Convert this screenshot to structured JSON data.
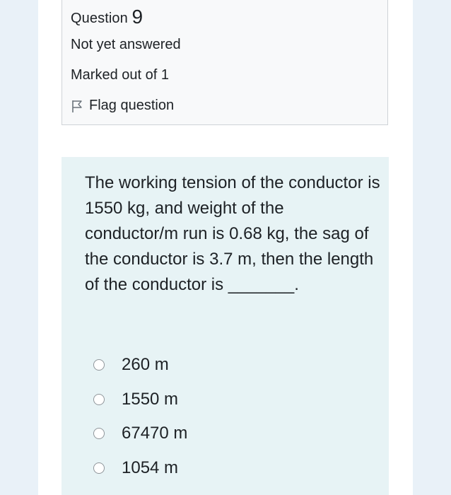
{
  "question_info": {
    "prefix": "Question",
    "number": "9",
    "state": "Not yet answered",
    "grade": "Marked out of 1",
    "flag_label": "Flag question"
  },
  "question": {
    "text": "The working tension of the conductor is 1550 kg, and weight of the conductor/m run is 0.68 kg, the sag of the conductor is 3.7 m, then the length of the conductor is _______.",
    "options": [
      {
        "label": "260 m"
      },
      {
        "label": "1550 m"
      },
      {
        "label": "67470 m"
      },
      {
        "label": "1054 m"
      }
    ]
  },
  "icons": {
    "flag": "flag-icon",
    "radio": "radio-unchecked-icon"
  },
  "colors": {
    "page_background": "#e9f1f8",
    "info_box_background": "#f8f9fa",
    "content_background": "#e7f3f5",
    "text": "#1d2125"
  }
}
